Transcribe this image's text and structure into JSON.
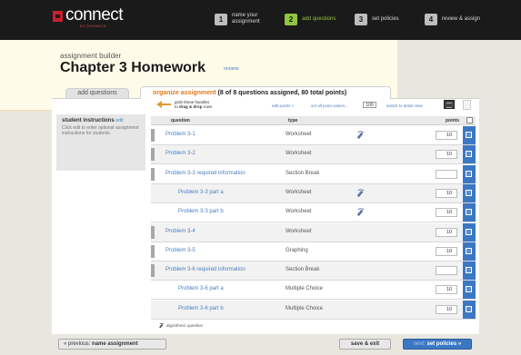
{
  "app": {
    "logo_text": "connect",
    "logo_sub": "ECONOMICS"
  },
  "steps": [
    {
      "num": "1",
      "label": "name your assignment",
      "active": false
    },
    {
      "num": "2",
      "label": "add questions",
      "active": true
    },
    {
      "num": "3",
      "label": "set policies",
      "active": false
    },
    {
      "num": "4",
      "label": "review & assign",
      "active": false
    }
  ],
  "header": {
    "builder_label": "assignment builder",
    "title": "Chapter 3 Homework",
    "rename": "rename"
  },
  "tabs": {
    "add": "add questions",
    "organize_link": "organize assignment",
    "organize_count": "(8 of 8 questions assigned, 80 total points)"
  },
  "sidebar": {
    "title": "student instructions",
    "edit": "edit",
    "text": "Click edit to enter optional assignment instructions for students."
  },
  "toolbar": {
    "drag_line1": "grab these handles",
    "drag_line2_pre": "to ",
    "drag_line2_bold": "drag & drop",
    "drag_line2_post": " rows",
    "edit_points": "edit points »",
    "set_all_points": "set all point values...",
    "points_value": "100",
    "switch_view": "switch to detail view"
  },
  "table": {
    "columns": {
      "question": "question",
      "type": "type",
      "points": "points"
    },
    "rows": [
      {
        "question": "Problem 3-1",
        "type": "Worksheet",
        "points": "10",
        "algo": true,
        "indent": false,
        "handle": true
      },
      {
        "question": "Problem 3-2",
        "type": "Worksheet",
        "points": "10",
        "algo": false,
        "indent": false,
        "handle": true
      },
      {
        "question": "Problem 3-3 required information",
        "type": "Section Break",
        "points": "",
        "algo": false,
        "indent": false,
        "handle": true
      },
      {
        "question": "Problem 3-3 part a",
        "type": "Worksheet",
        "points": "10",
        "algo": true,
        "indent": true,
        "handle": false
      },
      {
        "question": "Problem 3-3 part b",
        "type": "Worksheet",
        "points": "10",
        "algo": true,
        "indent": true,
        "handle": false
      },
      {
        "question": "Problem 3-4",
        "type": "Worksheet",
        "points": "10",
        "algo": false,
        "indent": false,
        "handle": true
      },
      {
        "question": "Problem 3-5",
        "type": "Graphing",
        "points": "10",
        "algo": false,
        "indent": false,
        "handle": true
      },
      {
        "question": "Problem 3-6 required information",
        "type": "Section Break",
        "points": "",
        "algo": false,
        "indent": false,
        "handle": true
      },
      {
        "question": "Problem 3-6 part a",
        "type": "Multiple Choice",
        "points": "10",
        "algo": false,
        "indent": true,
        "handle": false
      },
      {
        "question": "Problem 3-6 part b",
        "type": "Multiple Choice",
        "points": "10",
        "algo": false,
        "indent": true,
        "handle": false
      }
    ]
  },
  "legend": "algorithmic question",
  "footer": {
    "prev_pre": "« previous: ",
    "prev_bold": "name assignment",
    "save": "save & exit",
    "next_pre": "next: ",
    "next_bold": "set policies »"
  },
  "colors": {
    "accent_blue": "#3b78c4",
    "link_blue": "#4a7fc1",
    "active_green": "#8ec63f",
    "organize_orange": "#e37a1d"
  }
}
